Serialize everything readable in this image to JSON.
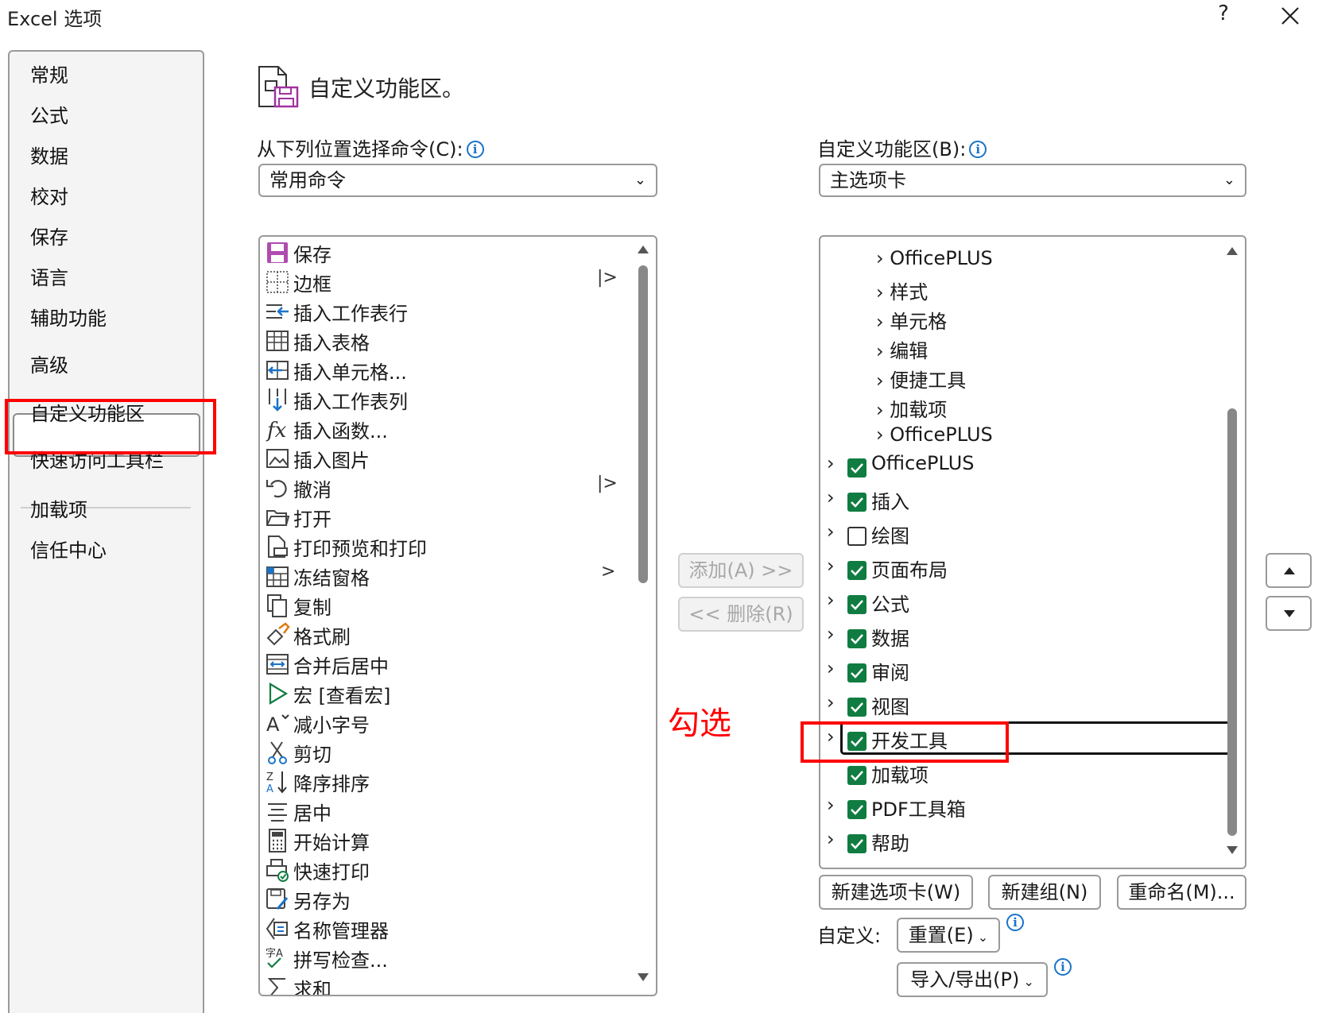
{
  "window": {
    "title": "Excel 选项",
    "help": "?",
    "close_icon": "close-icon"
  },
  "nav": {
    "items": [
      "常规",
      "公式",
      "数据",
      "校对",
      "保存",
      "语言",
      "辅助功能",
      "高级",
      "自定义功能区",
      "快速访问工具栏",
      "加载项",
      "信任中心"
    ],
    "selected": "自定义功能区"
  },
  "header": {
    "title": "自定义功能区。",
    "icon": "customize-ribbon-icon"
  },
  "left_panel": {
    "label": "从下列位置选择命令(C):",
    "dropdown_value": "常用命令",
    "commands": [
      {
        "label": "保存",
        "icon": "save-icon",
        "sub": ""
      },
      {
        "label": "边框",
        "icon": "borders-icon",
        "sub": "|>"
      },
      {
        "label": "插入工作表行",
        "icon": "insert-row-icon",
        "sub": ""
      },
      {
        "label": "插入表格",
        "icon": "insert-table-icon",
        "sub": ""
      },
      {
        "label": "插入单元格...",
        "icon": "insert-cells-icon",
        "sub": ""
      },
      {
        "label": "插入工作表列",
        "icon": "insert-column-icon",
        "sub": ""
      },
      {
        "label": "插入函数...",
        "icon": "function-icon",
        "sub": ""
      },
      {
        "label": "插入图片",
        "icon": "picture-icon",
        "sub": ""
      },
      {
        "label": "撤消",
        "icon": "undo-icon",
        "sub": "|>"
      },
      {
        "label": "打开",
        "icon": "open-folder-icon",
        "sub": ""
      },
      {
        "label": "打印预览和打印",
        "icon": "print-preview-icon",
        "sub": ""
      },
      {
        "label": "冻结窗格",
        "icon": "freeze-panes-icon",
        "sub": ">"
      },
      {
        "label": "复制",
        "icon": "copy-icon",
        "sub": ""
      },
      {
        "label": "格式刷",
        "icon": "format-painter-icon",
        "sub": ""
      },
      {
        "label": "合并后居中",
        "icon": "merge-center-icon",
        "sub": ""
      },
      {
        "label": "宏 [查看宏]",
        "icon": "macro-play-icon",
        "sub": ""
      },
      {
        "label": "减小字号",
        "icon": "decrease-font-icon",
        "sub": ""
      },
      {
        "label": "剪切",
        "icon": "scissors-icon",
        "sub": ""
      },
      {
        "label": "降序排序",
        "icon": "sort-desc-icon",
        "sub": ""
      },
      {
        "label": "居中",
        "icon": "align-center-icon",
        "sub": ""
      },
      {
        "label": "开始计算",
        "icon": "calculator-icon",
        "sub": ""
      },
      {
        "label": "快速打印",
        "icon": "quick-print-icon",
        "sub": ""
      },
      {
        "label": "另存为",
        "icon": "save-as-icon",
        "sub": ""
      },
      {
        "label": "名称管理器",
        "icon": "name-manager-icon",
        "sub": ""
      },
      {
        "label": "拼写检查...",
        "icon": "spelling-icon",
        "sub": ""
      },
      {
        "label": "求和",
        "icon": "sum-icon",
        "sub": ""
      }
    ]
  },
  "middle": {
    "add_label": "添加(A) >>",
    "remove_label": "<< 删除(R)"
  },
  "right_panel": {
    "label": "自定义功能区(B):",
    "dropdown_value": "主选项卡",
    "groups": [
      "OfficePLUS",
      "样式",
      "单元格",
      "编辑",
      "便捷工具",
      "加载项",
      "OfficePLUS"
    ],
    "tabs": [
      {
        "label": "OfficePLUS",
        "checked": true,
        "expandable": true
      },
      {
        "label": "插入",
        "checked": true,
        "expandable": true
      },
      {
        "label": "绘图",
        "checked": false,
        "expandable": true
      },
      {
        "label": "页面布局",
        "checked": true,
        "expandable": true
      },
      {
        "label": "公式",
        "checked": true,
        "expandable": true
      },
      {
        "label": "数据",
        "checked": true,
        "expandable": true
      },
      {
        "label": "审阅",
        "checked": true,
        "expandable": true
      },
      {
        "label": "视图",
        "checked": true,
        "expandable": true
      },
      {
        "label": "开发工具",
        "checked": true,
        "expandable": true
      },
      {
        "label": "加载项",
        "checked": true,
        "expandable": false
      },
      {
        "label": "PDF工具箱",
        "checked": true,
        "expandable": true
      },
      {
        "label": "帮助",
        "checked": true,
        "expandable": true
      }
    ],
    "new_tab_label": "新建选项卡(W)",
    "new_group_label": "新建组(N)",
    "rename_label": "重命名(M)...",
    "customize_label": "自定义:",
    "reset_label": "重置(E)",
    "import_export_label": "导入/导出(P)"
  },
  "annotation": {
    "text": "勾选",
    "color": "#ff0000"
  },
  "colors": {
    "checkbox_green": "#107c41",
    "info_blue": "#1a73c8",
    "highlight_red": "#ff0000"
  }
}
